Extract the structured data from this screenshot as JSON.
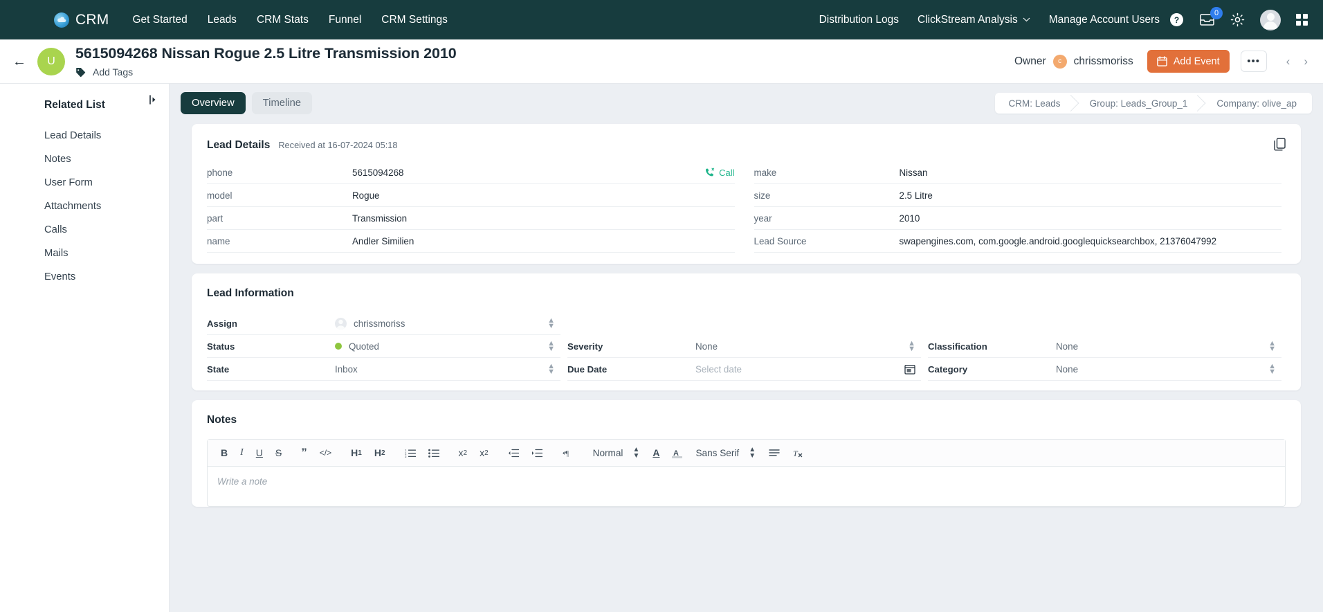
{
  "topnav": {
    "brand": "CRM",
    "links": [
      {
        "label": "Get Started"
      },
      {
        "label": "Leads"
      },
      {
        "label": "CRM Stats"
      },
      {
        "label": "Funnel"
      },
      {
        "label": "CRM Settings"
      }
    ],
    "right_links": [
      {
        "label": "Distribution Logs",
        "caret": false
      },
      {
        "label": "ClickStream Analysis",
        "caret": true
      },
      {
        "label": "Manage Account Users",
        "caret": false
      }
    ],
    "inbox_badge": "0"
  },
  "header": {
    "avatar_initial": "U",
    "title": "5615094268 Nissan Rogue 2.5 Litre Transmission 2010",
    "add_tags": "Add Tags",
    "owner_label": "Owner",
    "owner_initial": "c",
    "owner_name": "chrissmoriss",
    "add_event": "Add Event",
    "dots": "•••"
  },
  "sidebar": {
    "title": "Related List",
    "items": [
      {
        "label": "Lead Details"
      },
      {
        "label": "Notes"
      },
      {
        "label": "User Form"
      },
      {
        "label": "Attachments"
      },
      {
        "label": "Calls"
      },
      {
        "label": "Mails"
      },
      {
        "label": "Events"
      }
    ]
  },
  "tabs": [
    {
      "label": "Overview",
      "active": true
    },
    {
      "label": "Timeline",
      "active": false
    }
  ],
  "breadcrumb": [
    {
      "label": "CRM: Leads"
    },
    {
      "label": "Group: Leads_Group_1"
    },
    {
      "label": "Company: olive_ap"
    }
  ],
  "lead_details": {
    "title": "Lead Details",
    "received": "Received at 16-07-2024 05:18",
    "call_label": "Call",
    "left": [
      {
        "key": "phone",
        "value": "5615094268",
        "action": "call"
      },
      {
        "key": "model",
        "value": "Rogue"
      },
      {
        "key": "part",
        "value": "Transmission"
      },
      {
        "key": "name",
        "value": "Andler Similien"
      }
    ],
    "right": [
      {
        "key": "make",
        "value": "Nissan"
      },
      {
        "key": "size",
        "value": "2.5 Litre"
      },
      {
        "key": "year",
        "value": "2010"
      },
      {
        "key": "Lead Source",
        "value": "swapengines.com, com.google.android.googlequicksearchbox, 21376047992"
      }
    ]
  },
  "lead_information": {
    "title": "Lead Information",
    "col1": [
      {
        "key": "Assign",
        "value": "chrissmoriss",
        "type": "avatar-select"
      },
      {
        "key": "Status",
        "value": "Quoted",
        "type": "dot-select"
      },
      {
        "key": "State",
        "value": "Inbox",
        "type": "select"
      }
    ],
    "col2": [
      {
        "key": "",
        "value": "",
        "type": "blank"
      },
      {
        "key": "Severity",
        "value": "None",
        "type": "select"
      },
      {
        "key": "Due Date",
        "value": "Select date",
        "type": "date",
        "placeholder": true
      }
    ],
    "col3": [
      {
        "key": "",
        "value": "",
        "type": "blank"
      },
      {
        "key": "Classification",
        "value": "None",
        "type": "select"
      },
      {
        "key": "Category",
        "value": "None",
        "type": "select"
      }
    ]
  },
  "notes": {
    "title": "Notes",
    "toolbar": {
      "bold": "B",
      "italic": "I",
      "underline": "U",
      "strike": "S",
      "quote": "”",
      "code": "</>",
      "h1": "H",
      "h1_sub": "1",
      "h2": "H",
      "h2_sub": "2",
      "ordered_list": "ordered-list",
      "bullet_list": "bullet-list",
      "subscript": "x",
      "subscript_idx": "2",
      "superscript": "x",
      "superscript_idx": "2",
      "outdent": "outdent",
      "indent": "indent",
      "direction": "direction",
      "block_format": "Normal",
      "text_color": "A",
      "highlight": "A",
      "font_family": "Sans Serif",
      "align": "align",
      "clear_format": "Tx"
    },
    "placeholder": "Write a note"
  }
}
